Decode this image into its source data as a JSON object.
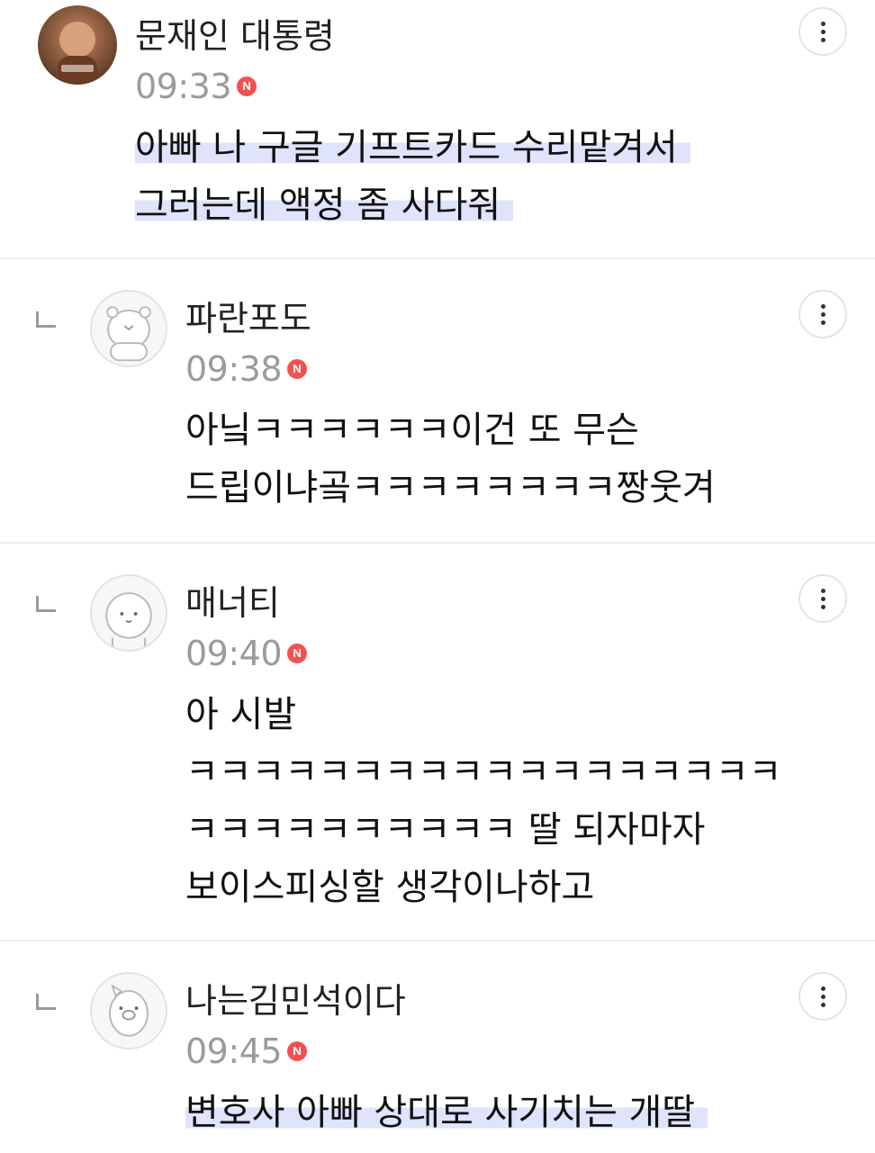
{
  "comments": [
    {
      "nickname": "문재인 대통령",
      "time": "09:33",
      "badge": "N",
      "lines": [
        "아빠 나 구글 기프트카드 수리맡겨서",
        "그러는데 액정 좀 사다줘"
      ],
      "highlighted": true
    },
    {
      "nickname": "파란포도",
      "time": "09:38",
      "badge": "N",
      "lines": [
        "아닠ㅋㅋㅋㅋㅋㅋ이건 또 무슨",
        "드립이냐곸ㅋㅋㅋㅋㅋㅋㅋㅋ짱웃겨"
      ],
      "highlighted": false
    },
    {
      "nickname": "매너티",
      "time": "09:40",
      "badge": "N",
      "lines": [
        "아 시발",
        "ㅋㅋㅋㅋㅋㅋㅋㅋㅋㅋㅋㅋㅋㅋㅋㅋㅋㅋ",
        "ㅋㅋㅋㅋㅋㅋㅋㅋㅋㅋ 딸 되자마자",
        "보이스피싱할 생각이나하고"
      ],
      "highlighted": false
    },
    {
      "nickname": "나는김민석이다",
      "time": "09:45",
      "badge": "N",
      "lines": [
        "변호사 아빠 상대로 사기치는 개딸"
      ],
      "highlighted": true
    }
  ],
  "icons": {
    "more": "more-vertical-icon",
    "reply": "reply-arrow-icon",
    "new": "new-badge-icon"
  },
  "colors": {
    "highlight": "#dfe3fb",
    "new_badge": "#f25151",
    "time": "#9b9b9b",
    "divider": "#ececec"
  }
}
